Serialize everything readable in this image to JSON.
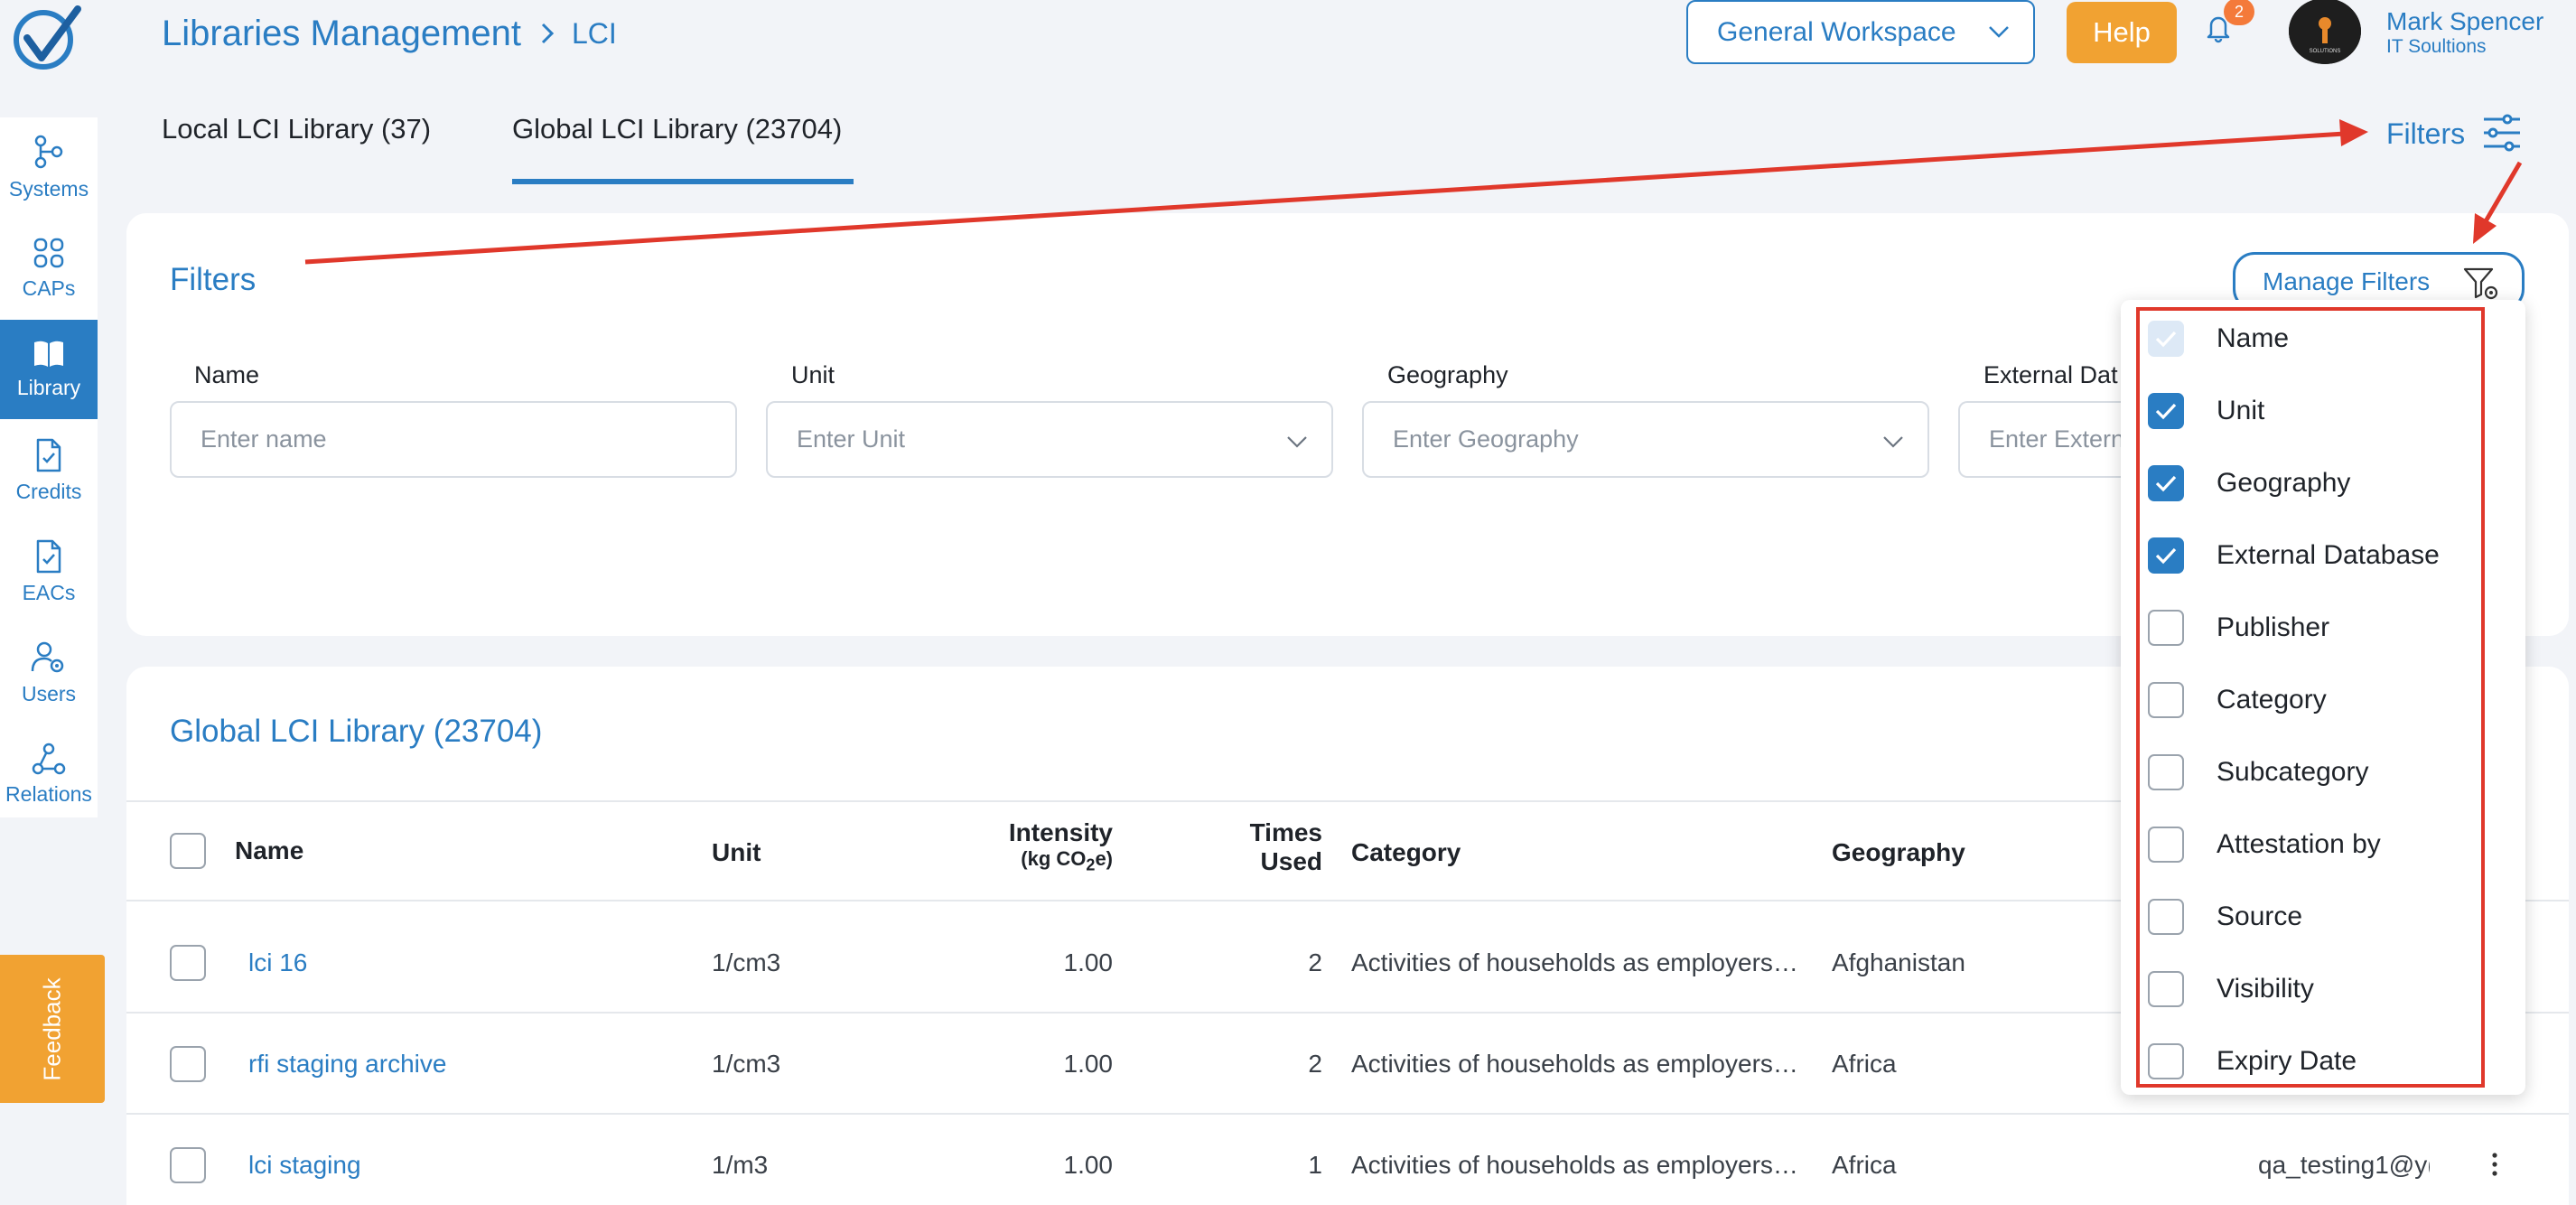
{
  "header": {
    "breadcrumb_root": "Libraries Management",
    "breadcrumb_current": "LCI",
    "workspace": "General Workspace",
    "help_label": "Help",
    "notifications_count": "2",
    "avatar_text": "SOLUTIONS",
    "user_name": "Mark Spencer",
    "user_org": "IT Soultions"
  },
  "sidebar": {
    "items": [
      {
        "label": "Systems",
        "icon": "systems-icon"
      },
      {
        "label": "CAPs",
        "icon": "grid-icon"
      },
      {
        "label": "Library",
        "icon": "book-icon",
        "active": true
      },
      {
        "label": "Credits",
        "icon": "document-check-icon"
      },
      {
        "label": "EACs",
        "icon": "document-check-icon"
      },
      {
        "label": "Users",
        "icon": "users-gear-icon"
      },
      {
        "label": "Relations",
        "icon": "relations-icon"
      }
    ]
  },
  "tabs": [
    {
      "label": "Local LCI Library (37)"
    },
    {
      "label": "Global LCI Library (23704)",
      "active": true
    }
  ],
  "filters_link": "Filters",
  "filter_panel": {
    "title": "Filters",
    "manage_label": "Manage Filters",
    "fields": [
      {
        "label": "Name",
        "placeholder": "Enter name"
      },
      {
        "label": "Unit",
        "placeholder": "Enter Unit"
      },
      {
        "label": "Geography",
        "placeholder": "Enter Geography"
      },
      {
        "label": "External Dat",
        "placeholder": "Enter Extern"
      }
    ]
  },
  "manage_filters_menu": [
    {
      "label": "Name",
      "checked": true,
      "disabled": true
    },
    {
      "label": "Unit",
      "checked": true
    },
    {
      "label": "Geography",
      "checked": true
    },
    {
      "label": "External Database",
      "checked": true
    },
    {
      "label": "Publisher",
      "checked": false
    },
    {
      "label": "Category",
      "checked": false
    },
    {
      "label": "Subcategory",
      "checked": false
    },
    {
      "label": "Attestation by",
      "checked": false
    },
    {
      "label": "Source",
      "checked": false
    },
    {
      "label": "Visibility",
      "checked": false
    },
    {
      "label": "Expiry Date",
      "checked": false
    }
  ],
  "table": {
    "title": "Global LCI Library (23704)",
    "headers": {
      "name": "Name",
      "unit": "Unit",
      "intensity": "Intensity",
      "intensity_unit_prefix": "(kg CO",
      "intensity_unit_sub": "2",
      "intensity_unit_suffix": "e)",
      "times_used_1": "Times",
      "times_used_2": "Used",
      "category": "Category",
      "geography": "Geography"
    },
    "rows": [
      {
        "name": "lci 16",
        "unit": "1/cm3",
        "intensity": "1.00",
        "times_used": "2",
        "category": "Activities of households as employers…",
        "geography": "Afghanistan",
        "extra": ""
      },
      {
        "name": "rfi staging archive",
        "unit": "1/cm3",
        "intensity": "1.00",
        "times_used": "2",
        "category": "Activities of households as employers…",
        "geography": "Africa",
        "extra": ""
      },
      {
        "name": "lci staging",
        "unit": "1/m3",
        "intensity": "1.00",
        "times_used": "1",
        "category": "Activities of households as employers…",
        "geography": "Africa",
        "extra": "qa_testing1@y("
      }
    ]
  },
  "feedback_label": "Feedback",
  "colors": {
    "primary": "#2a7dc3",
    "accent": "#f1a232",
    "annotation": "#e0382b"
  }
}
